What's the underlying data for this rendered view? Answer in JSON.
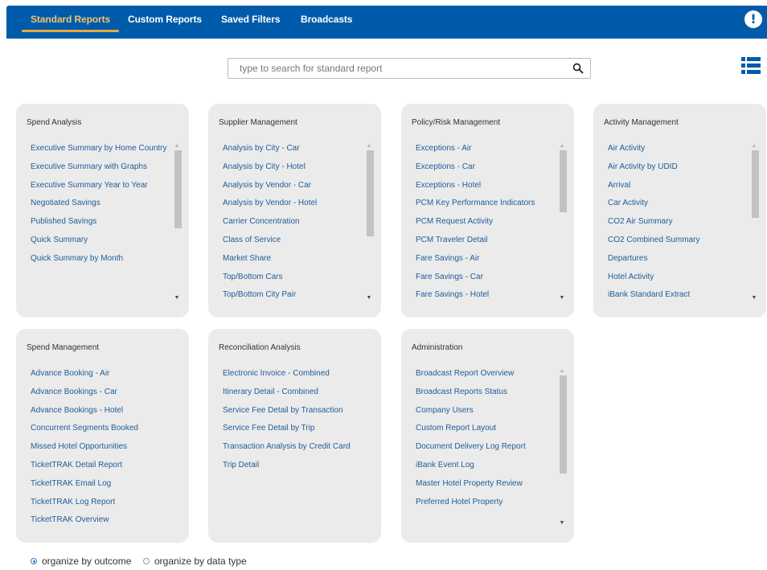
{
  "tabs": {
    "standard": "Standard Reports",
    "custom": "Custom Reports",
    "saved_filters": "Saved Filters",
    "broadcasts": "Broadcasts"
  },
  "alert_icon": "exclamation-circle-icon",
  "search": {
    "placeholder": "type to search for standard report",
    "icon": "search-icon"
  },
  "view_toggle_icon": "list-view-icon",
  "cards": {
    "spend_analysis": {
      "title": "Spend Analysis",
      "items": [
        "Executive Summary by Home Country",
        "Executive Summary with Graphs",
        "Executive Summary Year to Year",
        "Negotiated Savings",
        "Published Savings",
        "Quick Summary",
        "Quick Summary by Month"
      ]
    },
    "supplier_management": {
      "title": "Supplier Management",
      "items": [
        "Analysis by City - Car",
        "Analysis by City - Hotel",
        "Analysis by Vendor - Car",
        "Analysis by Vendor - Hotel",
        "Carrier Concentration",
        "Class of Service",
        "Market Share",
        "Top/Bottom Cars",
        "Top/Bottom City Pair"
      ]
    },
    "policy_risk": {
      "title": "Policy/Risk Management",
      "items": [
        "Exceptions - Air",
        "Exceptions - Car",
        "Exceptions - Hotel",
        "PCM Key Performance Indicators",
        "PCM Request Activity",
        "PCM Traveler Detail",
        "Fare Savings - Air",
        "Fare Savings - Car",
        "Fare Savings - Hotel"
      ]
    },
    "activity_management": {
      "title": "Activity Management",
      "items": [
        "Air Activity",
        "Air Activity by UDID",
        "Arrival",
        "Car Activity",
        "CO2 Air Summary",
        "CO2 Combined Summary",
        "Departures",
        "Hotel Activity",
        "iBank Standard Extract"
      ]
    },
    "spend_management": {
      "title": "Spend Management",
      "items": [
        "Advance Booking - Air",
        "Advance Bookings - Car",
        "Advance Bookings - Hotel",
        "Concurrent Segments Booked",
        "Missed Hotel Opportunities",
        "TicketTRAK Detail Report",
        "TicketTRAK Email Log",
        "TicketTRAK Log Report",
        "TicketTRAK Overview"
      ]
    },
    "reconciliation": {
      "title": "Reconciliation Analysis",
      "items": [
        "Electronic Invoice - Combined",
        "Itinerary Detail - Combined",
        "Service Fee Detail by Transaction",
        "Service Fee Detail by Trip",
        "Transaction Analysis by Credit Card",
        "Trip Detail"
      ]
    },
    "administration": {
      "title": "Administration",
      "items": [
        "Broadcast Report Overview",
        "Broadcast Reports Status",
        "Company Users",
        "Custom Report Layout",
        "Document Delivery Log Report",
        "iBank Event Log",
        "Master Hotel Property Review",
        "Preferred Hotel Property"
      ]
    }
  },
  "organize": {
    "by_outcome": "organize by outcome",
    "by_data_type": "organize by data type",
    "selected": "by_outcome"
  },
  "colors": {
    "nav_bg": "#005BAA",
    "active_tab_accent": "#E8A93D",
    "link": "#1F5C99",
    "card_bg": "#EBEBEB"
  }
}
